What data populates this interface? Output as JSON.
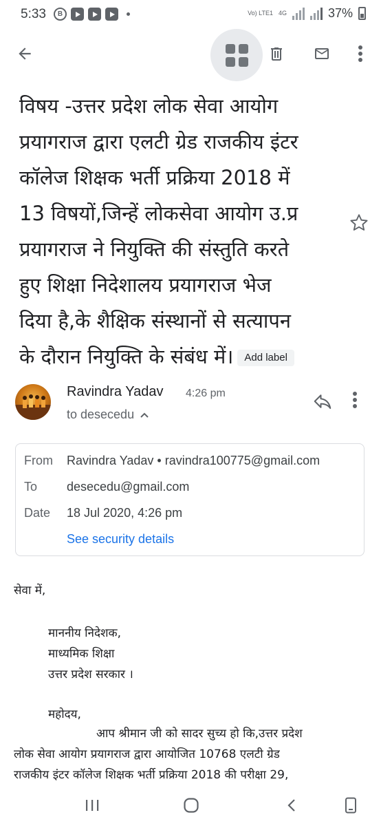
{
  "status_bar": {
    "time": "5:33",
    "network": "4G",
    "volte": "Vo) LTE1",
    "battery": "37%"
  },
  "toolbar": {
    "icons": [
      "back-arrow-icon",
      "apps-grid-icon",
      "delete-icon",
      "mail-icon",
      "more-vert-icon"
    ]
  },
  "email": {
    "subject_lines": [
      "विषय -उत्तर प्रदेश लोक सेवा आयोग",
      "प्रयागराज द्वारा एलटी ग्रेड राजकीय इंटर",
      "कॉलेज शिक्षक भर्ती प्रक्रिया 2018 में",
      "13 विषयों,जिन्हें लोकसेवा आयोग उ.प्र",
      "प्रयागराज ने  नियुक्ति की संस्तुति करते",
      "हुए शिक्षा निदेशालय प्रयागराज भेज",
      "दिया है,के शैक्षिक संस्थानों से सत्यापन",
      "के दौरान नियुक्ति के संबंध में।"
    ],
    "add_label": "Add label",
    "sender": {
      "name": "Ravindra Yadav",
      "time": "4:26 pm",
      "recipient_summary": "to desecedu"
    },
    "details": {
      "from_label": "From",
      "from_value": "Ravindra Yadav • ravindra100775@gmail.com",
      "to_label": "To",
      "to_value": "desecedu@gmail.com",
      "date_label": "Date",
      "date_value": "18 Jul 2020, 4:26 pm",
      "security_link": "See security details"
    },
    "body_lines": [
      "सेवा में,",
      "माननीय निदेशक,",
      "माध्यमिक शिक्षा",
      "उत्तर प्रदेश सरकार ।",
      "महोदय,",
      "आप श्रीमान जी को  सादर सुच्य हो कि,उत्तर प्रदेश",
      "लोक सेवा आयोग प्रयागराज द्वारा आयोजित 10768 एलटी ग्रेड",
      "राजकीय इंटर कॉलेज शिक्षक भर्ती प्रक्रिया 2018 की परीक्षा 29,"
    ]
  },
  "colors": {
    "link": "#1a73e8",
    "icon": "#5f6368",
    "text": "#202124"
  }
}
